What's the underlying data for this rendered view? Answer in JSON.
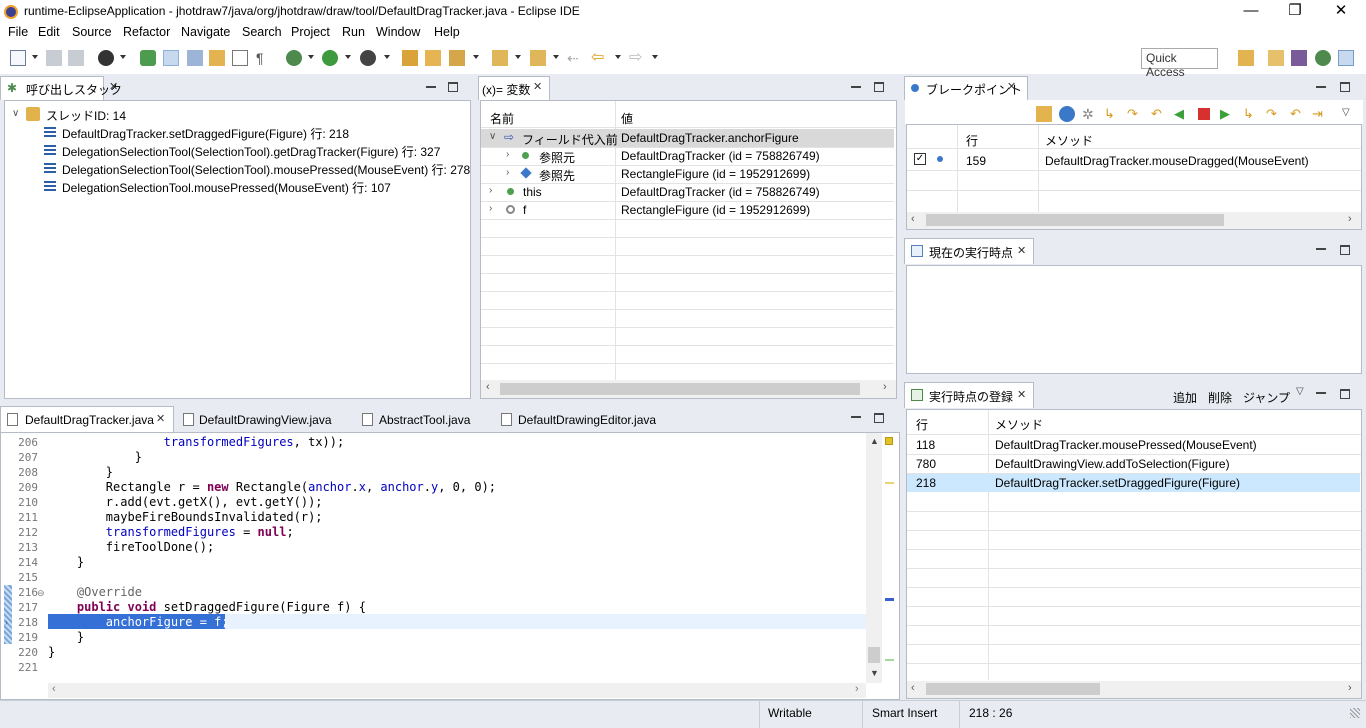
{
  "window": {
    "title": "runtime-EclipseApplication - jhotdraw7/java/org/jhotdraw/draw/tool/DefaultDragTracker.java - Eclipse IDE",
    "minimize": "—",
    "restore": "❐",
    "close": "✕"
  },
  "menu": [
    "File",
    "Edit",
    "Source",
    "Refactor",
    "Navigate",
    "Search",
    "Project",
    "Run",
    "Window",
    "Help"
  ],
  "toolbar": {
    "quick_access": "Quick Access"
  },
  "callstack": {
    "tab": "呼び出しスタック",
    "thread": "スレッドID: 14",
    "frames": [
      "DefaultDragTracker.setDraggedFigure(Figure) 行: 218",
      "DelegationSelectionTool(SelectionTool).getDragTracker(Figure) 行: 327",
      "DelegationSelectionTool(SelectionTool).mousePressed(MouseEvent) 行: 278",
      "DelegationSelectionTool.mousePressed(MouseEvent) 行: 107"
    ]
  },
  "variables": {
    "tab": "(x)= 変数",
    "col_name": "名前",
    "col_value": "値",
    "rows": [
      {
        "name": "フィールド代入前",
        "value": "DefaultDragTracker.anchorFigure"
      },
      {
        "name": "参照元",
        "value": "DefaultDragTracker (id = 758826749)"
      },
      {
        "name": "参照先",
        "value": "RectangleFigure (id = 1952912699)"
      },
      {
        "name": "this",
        "value": "DefaultDragTracker (id = 758826749)"
      },
      {
        "name": "f",
        "value": "RectangleFigure (id = 1952912699)"
      }
    ]
  },
  "breakpoints": {
    "tab": "ブレークポイント",
    "col_line": "行",
    "col_method": "メソッド",
    "rows": [
      {
        "line": "159",
        "method": "DefaultDragTracker.mouseDragged(MouseEvent)"
      }
    ]
  },
  "current_point": {
    "tab": "現在の実行時点"
  },
  "registered_points": {
    "tab": "実行時点の登録",
    "add": "追加",
    "delete": "削除",
    "jump": "ジャンプ",
    "col_line": "行",
    "col_method": "メソッド",
    "rows": [
      {
        "line": "118",
        "method": "DefaultDragTracker.mousePressed(MouseEvent)"
      },
      {
        "line": "780",
        "method": "DefaultDrawingView.addToSelection(Figure)"
      },
      {
        "line": "218",
        "method": "DefaultDragTracker.setDraggedFigure(Figure)"
      }
    ]
  },
  "editor": {
    "tabs": [
      "DefaultDragTracker.java",
      "DefaultDrawingView.java",
      "AbstractTool.java",
      "DefaultDrawingEditor.java"
    ],
    "line_numbers": [
      "206",
      "207",
      "208",
      "209",
      "210",
      "211",
      "212",
      "213",
      "214",
      "215",
      "216",
      "217",
      "218",
      "219",
      "220",
      "221"
    ]
  },
  "status": {
    "writable": "Writable",
    "insert_mode": "Smart Insert",
    "position": "218 : 26"
  }
}
